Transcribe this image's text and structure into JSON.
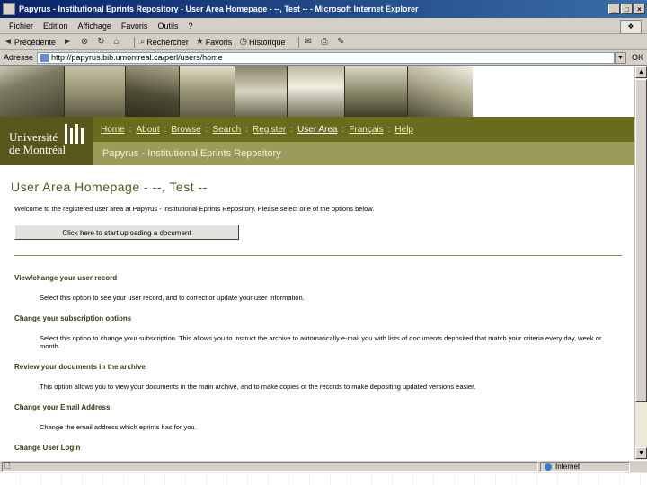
{
  "window": {
    "title": "Papyrus - Institutional Eprints Repository - User Area Homepage - --, Test -- - Microsoft Internet Explorer",
    "btn_min": "_",
    "btn_max": "□",
    "btn_close": "×"
  },
  "menubar": {
    "items": [
      "Fichier",
      "Edition",
      "Affichage",
      "Favoris",
      "Outils",
      "?"
    ]
  },
  "toolbar": {
    "back": "Précédente",
    "search": "Rechercher",
    "favorites": "Favoris",
    "history": "Historique",
    "back_icon": "◄",
    "forward_icon": "►",
    "stop_icon": "⊗",
    "refresh_icon": "↻",
    "home_icon": "⌂",
    "search_icon": "⌕",
    "favorites_icon": "★",
    "history_icon": "◷",
    "mail_icon": "✉",
    "print_icon": "⎙",
    "edit_icon": "✎"
  },
  "address": {
    "label": "Adresse",
    "value": "http://papyrus.bib.umontreal.ca/perl/users/home",
    "go": "OK",
    "dropdown_icon": "▼"
  },
  "site": {
    "university_line1": "Université",
    "university_line2": "de Montréal",
    "nav": [
      {
        "label": "Home",
        "active": false
      },
      {
        "label": "About",
        "active": false
      },
      {
        "label": "Browse",
        "active": false
      },
      {
        "label": "Search",
        "active": false
      },
      {
        "label": "Register",
        "active": false
      },
      {
        "label": "User Area",
        "active": true
      },
      {
        "label": "Français",
        "active": false
      },
      {
        "label": "Help",
        "active": false
      }
    ],
    "nav_separator": ":",
    "repository_name": "Papyrus - Institutional Eprints Repository"
  },
  "page": {
    "heading": "User Area Homepage - --, Test --",
    "welcome": "Welcome to the registered user area at Papyrus - Institutional Eprints Repository. Please select one of the options below.",
    "upload_button": "Click here to start uploading a document",
    "options": [
      {
        "title": "View/change your user record",
        "description": "Select this option to see your user record, and to correct or update your user information."
      },
      {
        "title": "Change your subscription options",
        "description": "Select this option to change your subscription. This allows you to instruct the archive to automatically e-mail you with lists of documents deposited that match your criteria every day, week or month."
      },
      {
        "title": "Review your documents in the archive",
        "description": "This option allows you to view your documents in the main archive, and to make copies of the records to make depositing updated versions easier."
      },
      {
        "title": "Change your Email Address",
        "description": "Change the email address which eprints has for you."
      },
      {
        "title": "Change User Login",
        "description": ""
      }
    ]
  },
  "statusbar": {
    "zone": "Internet"
  }
}
